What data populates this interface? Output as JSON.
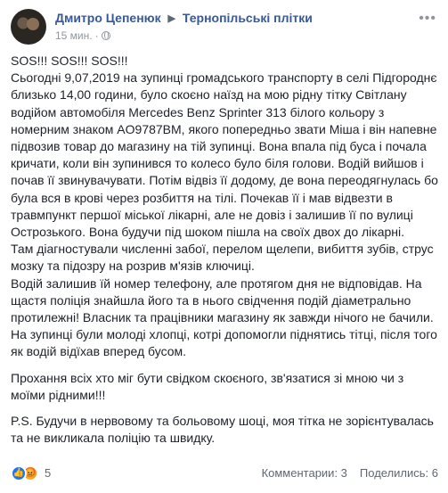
{
  "post": {
    "author": "Дмитро Цепенюк",
    "group": "Тернопільські плітки",
    "time": "15 мин.",
    "paragraphs": [
      "SOS!!! SOS!!! SOS!!!",
      "Сьогодні 9,07,2019 на зупинці громадського транспорту в селі Підгороднє близько 14,00 години, було скоєно наїзд на мою рідну тітку Світлану водійом автомобіля Mercedes Benz Sprinter 313 білого кольору з номерним знаком AO9787BM, якого попередньо звати Міша і він напевне підвозив товар до магазину на тій зупинці. Вона впала під буса і почала кричати, коли він зупинився то колесо було біля голови. Водій вийшов і почав її звинувачувати. Потім відвіз її додому, де вона переодягнулась бо була вся в крові через розбиття на тілі. Почекав її і мав відвезти в травмпункт першої міської лікарні, але не довіз і залишив її по вулиці Острозького. Вона будучи під шоком пішла на своїх двох до лікарні.",
      "Там діагностували численні забої, перелом щелепи, вибиття зубів, струс мозку та підозру на розрив м'язів ключиці.",
      "Водій залишив їй номер телефону, але протягом дня не відповідав. На щастя поліція знайшла його та в нього свідчення подій діаметрально протилежні! Власник та працівники магазину як завжди нічого не бачили.",
      "На зупинці були молоді хлопці, котрі допомогли піднятись тітці, після того як водій відїхав вперед бусом.",
      "Прохання всіх хто міг бути свідком скоєного, зв'язатися зі мною чи з моїми рідними!!!",
      "P.S. Будучи в нервовому та больовому шоці, моя тітка не зорієнтувалась та не викликала поліцію та швидку."
    ],
    "reactions_count": "5",
    "comments": "Комментарии: 3",
    "shares": "Поделились: 6"
  },
  "icons": [
    "avatar-photo",
    "arrow-right-icon",
    "globe-icon",
    "more-icon",
    "like-icon",
    "angry-icon"
  ],
  "colors": {
    "link": "#385898",
    "text": "#1d2129",
    "meta": "#90949c",
    "like": "#1877f2"
  }
}
